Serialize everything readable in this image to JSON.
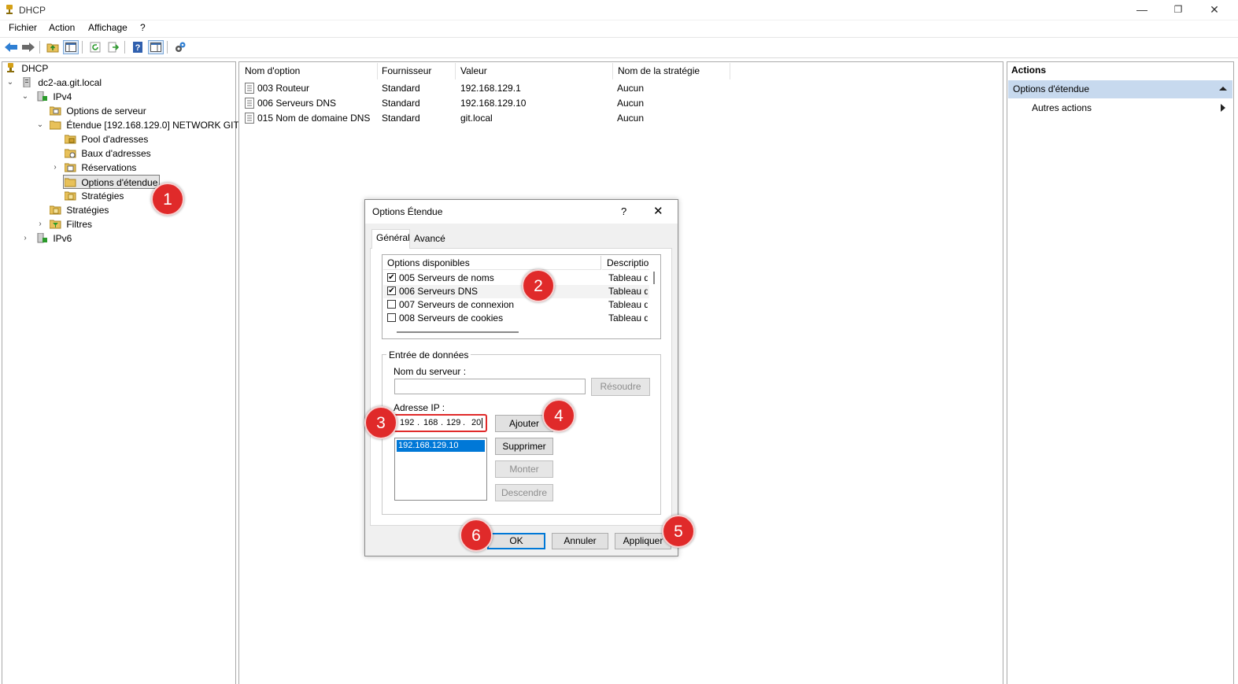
{
  "window": {
    "title": "DHCP",
    "controls": {
      "minimize": "—",
      "restore": "❐",
      "close": "✕"
    }
  },
  "menu": [
    "Fichier",
    "Action",
    "Affichage",
    "?"
  ],
  "toolbar": [
    "back-icon",
    "forward-icon",
    "folder-up-icon",
    "show-tree-icon",
    "refresh-icon",
    "export-icon",
    "help-icon",
    "properties-icon",
    "dhcp-config-icon"
  ],
  "tree": {
    "root": "DHCP",
    "server": "dc2-aa.git.local",
    "ipv4": "IPv4",
    "server_options": "Options de serveur",
    "scope": "Étendue [192.168.129.0] NETWORK GIT",
    "address_pool": "Pool d'adresses",
    "address_leases": "Baux d'adresses",
    "reservations": "Réservations",
    "scope_options": "Options d'étendue",
    "scope_policies": "Stratégies",
    "policies": "Stratégies",
    "filters": "Filtres",
    "ipv6": "IPv6"
  },
  "list": {
    "headers": [
      "Nom d'option",
      "Fournisseur",
      "Valeur",
      "Nom de la stratégie"
    ],
    "rows": [
      {
        "name": "003 Routeur",
        "vendor": "Standard",
        "value": "192.168.129.1",
        "policy": "Aucun"
      },
      {
        "name": "006 Serveurs DNS",
        "vendor": "Standard",
        "value": "192.168.129.10",
        "policy": "Aucun"
      },
      {
        "name": "015 Nom de domaine DNS",
        "vendor": "Standard",
        "value": "git.local",
        "policy": "Aucun"
      }
    ]
  },
  "actions": {
    "title": "Actions",
    "section": "Options d'étendue",
    "more": "Autres actions"
  },
  "dialog": {
    "title": "Options Étendue",
    "help": "?",
    "close": "✕",
    "tabs": [
      "Général",
      "Avancé"
    ],
    "options_header": {
      "name": "Options disponibles",
      "desc": "Descriptior"
    },
    "options": [
      {
        "label": "005 Serveurs de noms",
        "desc": "Tableau de",
        "checked": "✔"
      },
      {
        "label": "006 Serveurs DNS",
        "desc": "Tableau de",
        "checked": "✔"
      },
      {
        "label": "007 Serveurs de connexion",
        "desc": "Tableau de",
        "checked": ""
      },
      {
        "label": "008 Serveurs de cookies",
        "desc": "Tableau de",
        "checked": ""
      }
    ],
    "group_title": "Entrée de données",
    "server_name_label": "Nom du serveur :",
    "server_name_value": "",
    "resolve_button": "Résoudre",
    "ip_label": "Adresse IP :",
    "ip_octets": [
      "192",
      "168",
      "129",
      "20"
    ],
    "ip_dot": ".",
    "add_button": "Ajouter",
    "remove_button": "Supprimer",
    "up_button": "Monter",
    "down_button": "Descendre",
    "ip_list": [
      "192.168.129.10"
    ],
    "ok_button": "OK",
    "cancel_button": "Annuler",
    "apply_button": "Appliquer"
  },
  "callouts": [
    "1",
    "2",
    "3",
    "4",
    "5",
    "6"
  ],
  "colors": {
    "callout": "#e02a2a",
    "selection": "#0078d7",
    "actions_header": "#c7d9ee",
    "highlight_box": "#e02a2a"
  }
}
